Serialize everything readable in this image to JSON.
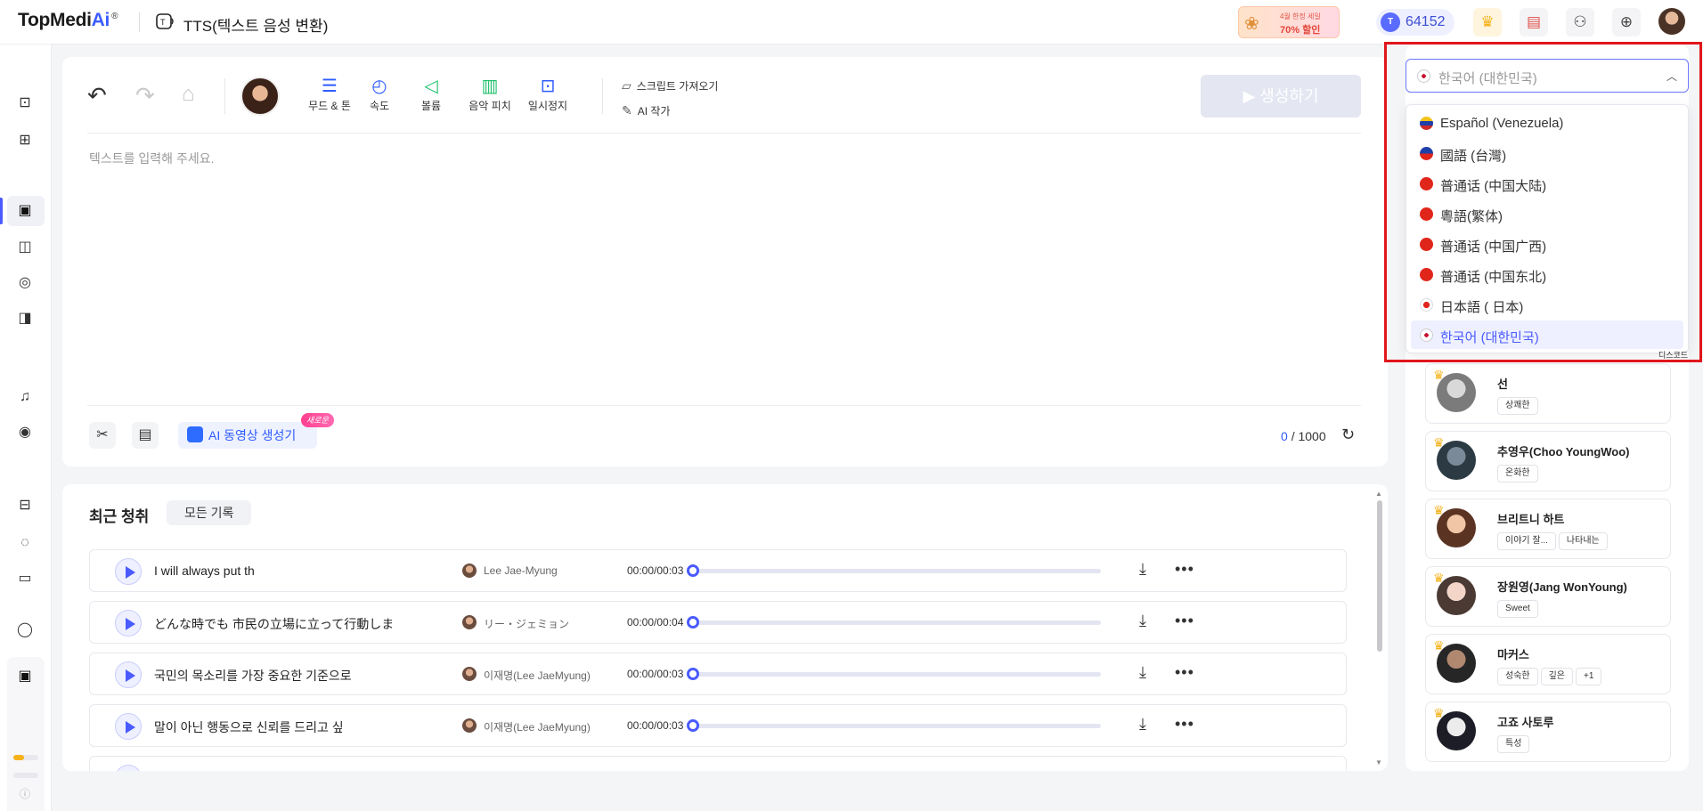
{
  "header": {
    "logo_main": "TopMedi",
    "logo_accent": "Ai",
    "logo_reg": "®",
    "page_title": "TTS(텍스트 음성 변환)",
    "promo_line1": "4월 한정 세일",
    "promo_line2": "70% 할인",
    "credits_coin": "T",
    "credits": "64152"
  },
  "toolbar": {
    "tools": [
      {
        "label": "무드 & 톤",
        "icon": "sliders-icon"
      },
      {
        "label": "속도",
        "icon": "speed-icon"
      },
      {
        "label": "볼륨",
        "icon": "volume-icon"
      },
      {
        "label": "음악 피치",
        "icon": "pitch-icon"
      },
      {
        "label": "일시정지",
        "icon": "pause-icon"
      }
    ],
    "script_import": "스크립트 가져오기",
    "ai_writer": "AI 작가",
    "generate": "생성하기"
  },
  "editor": {
    "placeholder": "텍스트를 입력해 주세요.",
    "ai_video": "AI 동영상 생성기",
    "new_badge": "새로운",
    "count": "0",
    "max": "/ 1000"
  },
  "history": {
    "title": "최근 청취",
    "all_records": "모든 기록",
    "rows": [
      {
        "text": "I will always put th",
        "voice": "Lee Jae-Myung",
        "time": "00:00/00:03"
      },
      {
        "text": "どんな時でも 市民の立場に立って行動しま",
        "voice": "リー・ジェミョン",
        "time": "00:00/00:04"
      },
      {
        "text": "국민의 목소리를 가장 중요한 기준으로",
        "voice": "이재명(Lee JaeMyung)",
        "time": "00:00/00:03"
      },
      {
        "text": "말이 아닌 행동으로 신뢰를 드리고 싶",
        "voice": "이재명(Lee JaeMyung)",
        "time": "00:00/00:03"
      }
    ]
  },
  "language": {
    "selected": "한국어 (대한민국)",
    "options": [
      {
        "label": "Español (Venezuela)",
        "color": "#f3c21a"
      },
      {
        "label": "國語 (台灣)",
        "color": "#1f3fa8"
      },
      {
        "label": "普通话 (中国大陆)",
        "color": "#e0261b"
      },
      {
        "label": "粵語(繁体)",
        "color": "#e0261b"
      },
      {
        "label": "普通话 (中国广西)",
        "color": "#e0261b"
      },
      {
        "label": "普通话 (中国东北)",
        "color": "#e0261b"
      },
      {
        "label": "日本語 ( 日本)",
        "color": "#e0261b"
      },
      {
        "label": "한국어 (대한민국)",
        "color": "#ffffff"
      }
    ],
    "tooltip": "디스코드"
  },
  "voices": [
    {
      "name": "선",
      "tags": [
        "상쾌한"
      ],
      "colors": [
        "#d9d9d9",
        "#7b7b7b"
      ]
    },
    {
      "name": "추영우(Choo YoungWoo)",
      "tags": [
        "온화한"
      ],
      "colors": [
        "#7a8a99",
        "#2c3a44"
      ]
    },
    {
      "name": "브리트니 하트",
      "tags": [
        "이야기 잘...",
        "나타내는"
      ],
      "colors": [
        "#f1c6a6",
        "#5a3322"
      ]
    },
    {
      "name": "장원영(Jang WonYoung)",
      "tags": [
        "Sweet"
      ],
      "colors": [
        "#f3d6c8",
        "#4b3a34"
      ]
    },
    {
      "name": "마커스",
      "tags": [
        "성숙한",
        "깊은",
        "+1"
      ],
      "colors": [
        "#b08870",
        "#262626"
      ]
    },
    {
      "name": "고죠 사토루",
      "tags": [
        "특성"
      ],
      "colors": [
        "#ececec",
        "#1d1d27"
      ]
    }
  ],
  "colors": {
    "accent": "#4a5bff",
    "highlight_frame": "#e0161c",
    "generate_disabled": "#e4e6f2"
  }
}
